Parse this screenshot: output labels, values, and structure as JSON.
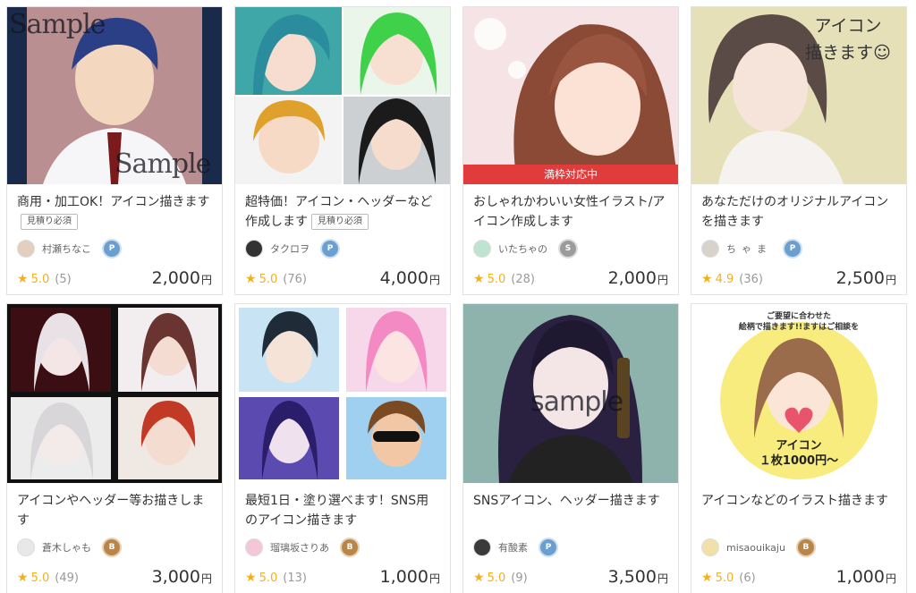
{
  "colors": {
    "accent_star": "#f2b01e",
    "banner_red": "#e23b3b"
  },
  "cards": [
    {
      "watermark": "Sample",
      "title": "商用・加工OK！アイコン描きます",
      "tag": "見積り必須",
      "seller": "村瀬ちなこ",
      "rank": "platinum",
      "rating": "5.0",
      "reviews": "(5)",
      "price": "2,000",
      "yen": "円"
    },
    {
      "title": "超特価！アイコン・ヘッダーなど作成します",
      "tag": "見積り必須",
      "seller": "タクロヲ",
      "rank": "platinum",
      "rating": "5.0",
      "reviews": "(76)",
      "price": "4,000",
      "yen": "円"
    },
    {
      "banner": "満枠対応中",
      "title": "おしゃれかわいい女性イラスト/アイコン作成します",
      "seller": "いたちゃの",
      "rank": "silver",
      "rating": "5.0",
      "reviews": "(28)",
      "price": "2,000",
      "yen": "円"
    },
    {
      "thumb_text": "アイコン\n描きます☺",
      "title": "あなただけのオリジナルアイコンを描きます",
      "seller": "ちゃま",
      "rank": "platinum",
      "rating": "4.9",
      "reviews": "(36)",
      "price": "2,500",
      "yen": "円"
    },
    {
      "title": "アイコンやヘッダー等お描きします",
      "seller": "蒼木しゃも",
      "rank": "bronze",
      "rating": "5.0",
      "reviews": "(49)",
      "price": "3,000",
      "yen": "円"
    },
    {
      "title": "最短1日・塗り選べます！SNS用のアイコン描きます",
      "seller": "瑠璃坂さりあ",
      "rank": "bronze",
      "rating": "5.0",
      "reviews": "(13)",
      "price": "1,000",
      "yen": "円"
    },
    {
      "watermark": "sample",
      "title": "SNSアイコン、ヘッダー描きます",
      "seller": "有酸素",
      "rank": "platinum",
      "rating": "5.0",
      "reviews": "(9)",
      "price": "3,500",
      "yen": "円"
    },
    {
      "thumb_top": "ご要望に合わせた\n絵柄で描きます!!ますはご相談を",
      "thumb_bottom": "アイコン\n１枚1000円〜",
      "title": "アイコンなどのイラスト描きます",
      "seller": "misaouikaju",
      "rank": "bronze",
      "rating": "5.0",
      "reviews": "(6)",
      "price": "1,000",
      "yen": "円"
    }
  ]
}
